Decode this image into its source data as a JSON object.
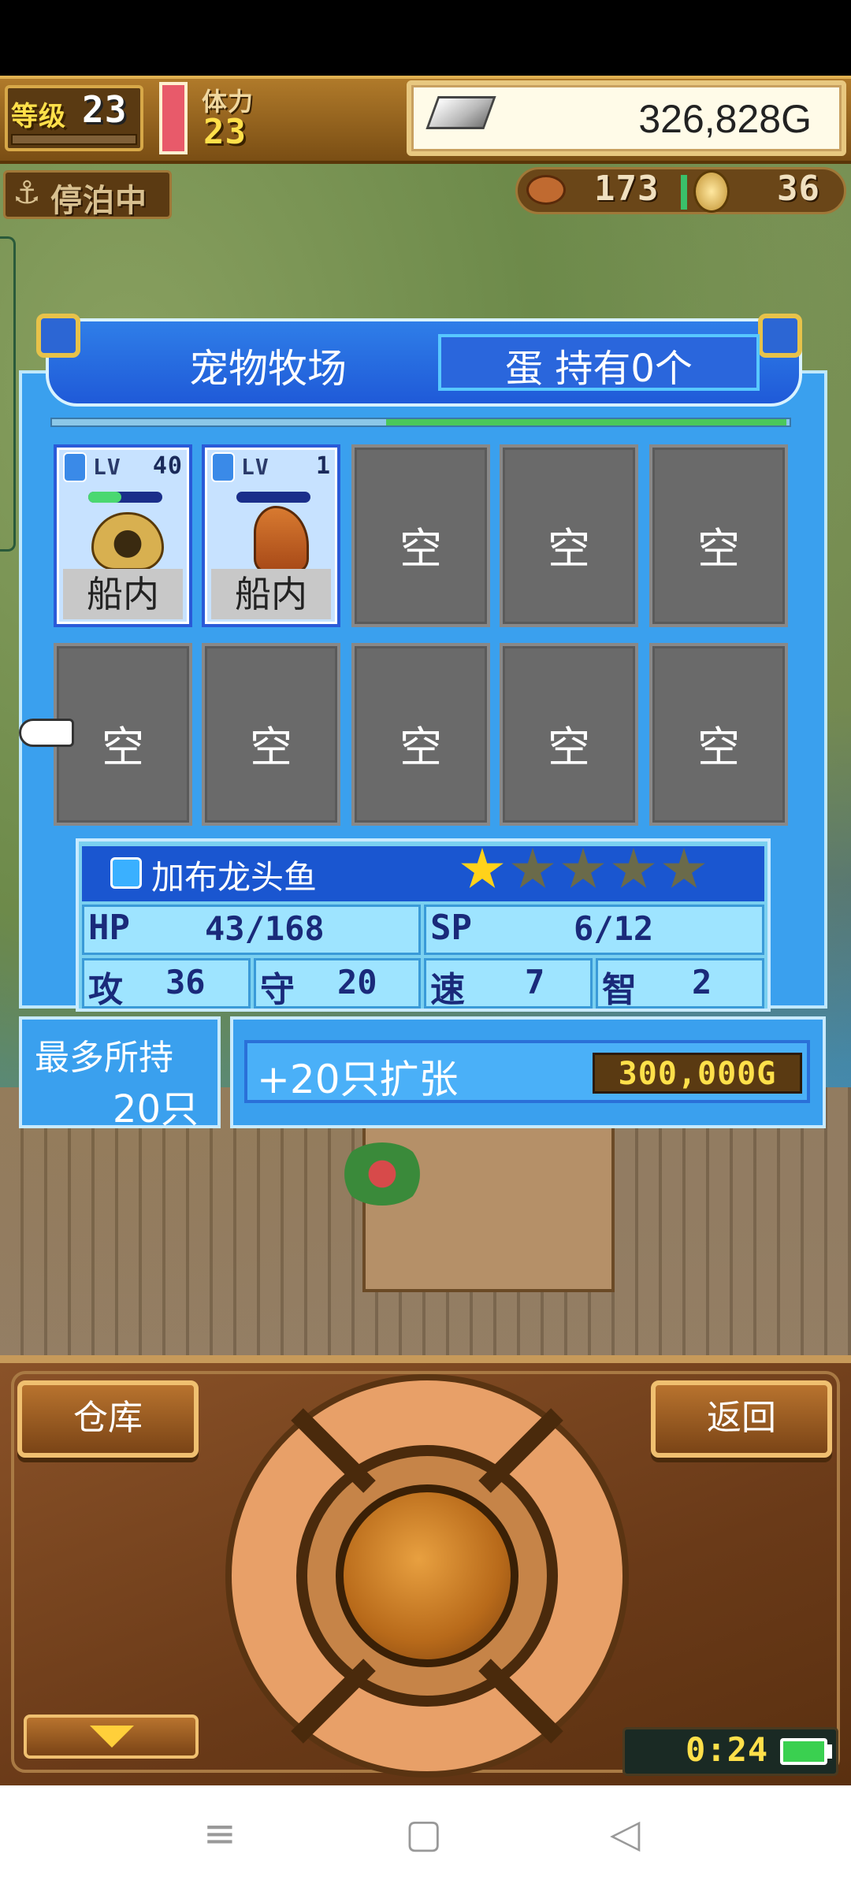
{
  "hud": {
    "level_label": "等级",
    "level": "23",
    "stamina_label": "体力",
    "stamina": "23",
    "gold": "326,828G",
    "status": "停泊中",
    "food": "173",
    "medals": "36"
  },
  "panel": {
    "title": "宠物牧场",
    "eggs": "蛋 持有0个",
    "slots": [
      {
        "level_label": "LV",
        "level": "40",
        "location": "船内",
        "hp_fraction": 0.45
      },
      {
        "level_label": "LV",
        "level": "1",
        "location": "船内",
        "hp_fraction": 0.0
      }
    ],
    "empty_label": "空"
  },
  "info": {
    "name": "加布龙头鱼",
    "stars": 1,
    "stars_max": 5,
    "hp_label": "HP",
    "hp": "43/168",
    "sp_label": "SP",
    "sp": "6/12",
    "atk_label": "攻",
    "atk": "36",
    "def_label": "守",
    "def": "20",
    "spd_label": "速",
    "spd": "7",
    "int_label": "智",
    "int": "2"
  },
  "capacity": {
    "label": "最多所持",
    "value": "20只",
    "expand_label": "+20只扩张",
    "expand_cost": "300,000G"
  },
  "controls": {
    "warehouse": "仓库",
    "back": "返回",
    "clock": "0:24"
  },
  "colors": {
    "panel_blue": "#3aa0ee",
    "gold_text": "#ffe04a",
    "star_on": "#ffd21a",
    "star_off": "#6a6a4a"
  },
  "icons": {
    "nav_menu": "≡",
    "nav_home": "▢",
    "nav_back": "◁"
  }
}
